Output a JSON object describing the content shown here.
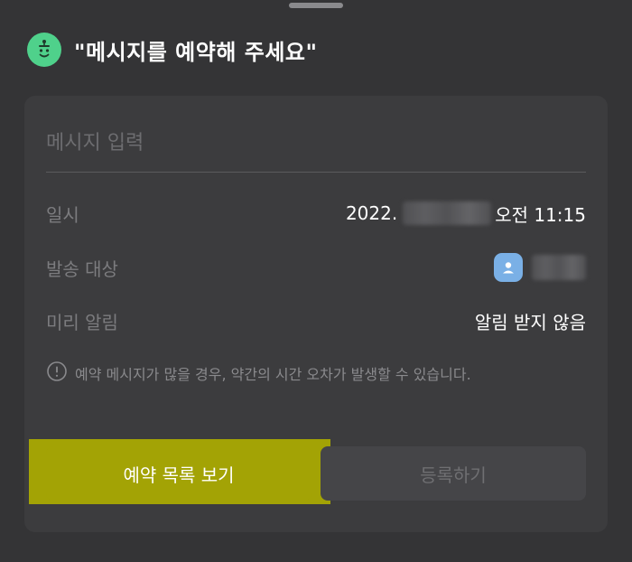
{
  "header": {
    "title": "\"메시지를 예약해 주세요\"",
    "bot_icon": "bot-face-icon"
  },
  "form": {
    "message_placeholder": "메시지 입력",
    "message_value": "",
    "date_label": "일시",
    "date_prefix": "2022.",
    "date_time": "오전 11:15",
    "recipient_label": "발송 대상",
    "recipient_icon": "profile-icon",
    "reminder_label": "미리 알림",
    "reminder_value": "알림 받지 않음",
    "notice_icon": "info-circle-icon",
    "notice": "예약 메시지가 많을 경우, 약간의 시간 오차가 발생할 수 있습니다."
  },
  "buttons": {
    "view_list": "예약 목록 보기",
    "register": "등록하기"
  },
  "colors": {
    "background": "#343436",
    "card": "#3c3c3e",
    "accent_green": "#4fd18b",
    "highlight": "#a3a305",
    "profile_blue": "#7ab0e6"
  }
}
